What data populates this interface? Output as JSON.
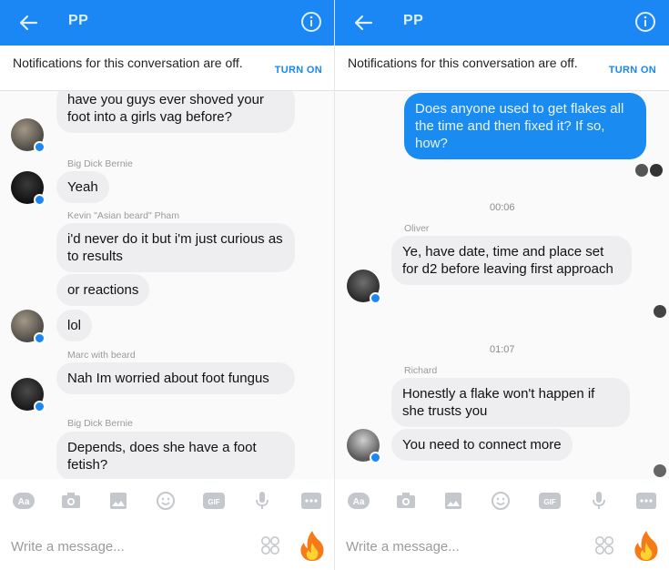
{
  "header": {
    "title": "PP"
  },
  "notice": {
    "text": "Notifications for this conversation are off.",
    "action": "TURN ON"
  },
  "left": {
    "messages": [
      {
        "text": "have you guys ever shoved your foot into a girls vag before?"
      },
      {
        "sender": "Big Dick Bernie",
        "text": "Yeah"
      },
      {
        "sender": "Kevin \"Asian beard\" Pham",
        "text": "i'd never do it but i'm just curious as to results"
      },
      {
        "text": "or reactions"
      },
      {
        "text": "lol"
      },
      {
        "sender": "Marc with beard",
        "text": "Nah Im worried about foot fungus"
      },
      {
        "sender": "Big Dick Bernie",
        "text": "Depends, does she have a foot fetish?"
      }
    ]
  },
  "right": {
    "messages": [
      {
        "text": "Does anyone used to get flakes all the time and then fixed it? If so, how?"
      },
      {
        "time": "00:06"
      },
      {
        "sender": "Oliver",
        "text": "Ye, have date, time and place set for d2 before leaving first approach"
      },
      {
        "time": "01:07"
      },
      {
        "sender": "Richard",
        "text": "Honestly a flake won't happen if she trusts you"
      },
      {
        "text": "You need to connect more"
      }
    ]
  },
  "toolbar": {
    "icons": [
      "aa-icon",
      "camera-icon",
      "image-icon",
      "emoji-icon",
      "gif-icon",
      "microphone-icon",
      "more-icon"
    ],
    "gif_label": "GIF",
    "aa_label": "Aa"
  },
  "compose": {
    "placeholder": "Write a message..."
  },
  "colors": {
    "accent": "#1a87f5",
    "bubble_other": "#eeeef1",
    "bubble_mine": "#1a8bf0"
  }
}
